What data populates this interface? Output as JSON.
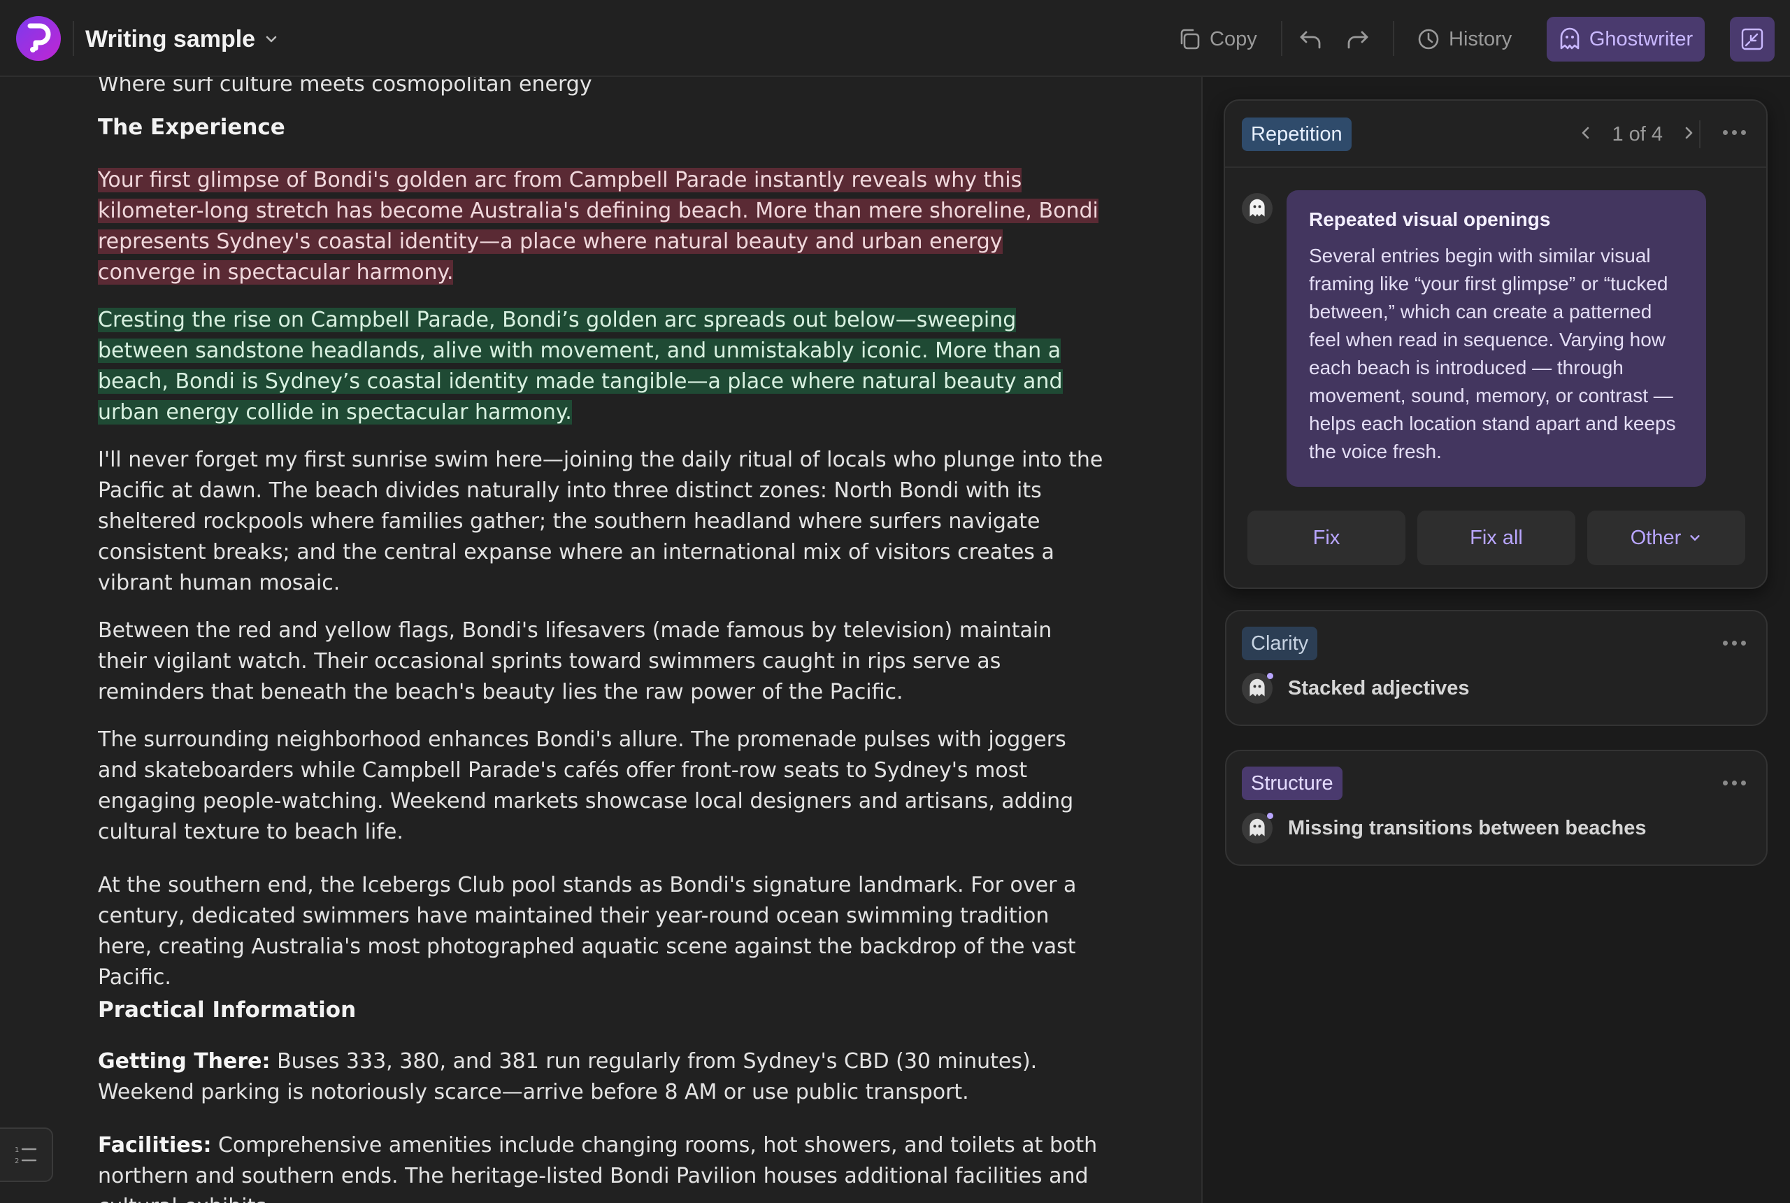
{
  "header": {
    "doc_title": "Writing sample",
    "copy_label": "Copy",
    "history_label": "History",
    "ghostwriter_label": "Ghostwriter"
  },
  "document": {
    "intro_line": "Where surf culture meets cosmopolitan energy",
    "heading_experience": "The Experience",
    "para_original": "Your first glimpse of Bondi's golden arc from Campbell Parade instantly reveals why this kilometer-long stretch has become Australia's defining beach. More than mere shoreline, Bondi represents Sydney's coastal identity—a place where natural beauty and urban energy converge in spectacular harmony.",
    "para_suggested": "Cresting the rise on Campbell Parade, Bondi’s golden arc spreads out below—sweeping between sandstone headlands, alive with movement, and unmistakably iconic. More than a beach, Bondi is Sydney’s coastal identity made tangible—a place where natural beauty and urban energy collide in spectacular harmony.",
    "para_swim": "I'll never forget my first sunrise swim here—joining the daily ritual of locals who plunge into the Pacific at dawn. The beach divides naturally into three distinct zones: North Bondi with its sheltered rockpools where families gather; the southern headland where surfers navigate consistent breaks; and the central expanse where an international mix of visitors creates a vibrant human mosaic.",
    "para_flags": "Between the red and yellow flags, Bondi's lifesavers (made famous by television) maintain their vigilant watch. Their occasional sprints toward swimmers caught in rips serve as reminders that beneath the beach's beauty lies the raw power of the Pacific.",
    "para_neighborhood": "The surrounding neighborhood enhances Bondi's allure. The promenade pulses with joggers and skateboarders while Campbell Parade's cafés offer front-row seats to Sydney's most engaging people-watching. Weekend markets showcase local designers and artisans, adding cultural texture to beach life.",
    "para_icebergs": "At the southern end, the Icebergs Club pool stands as Bondi's signature landmark. For over a century, dedicated swimmers have maintained their year-round ocean swimming tradition here, creating Australia's most photographed aquatic scene against the backdrop of the vast Pacific.",
    "heading_practical": "Practical Information",
    "getting_there_label": "Getting There:",
    "getting_there_text": " Buses 333, 380, and 381 run regularly from Sydney's CBD (30 minutes). Weekend parking is notoriously scarce—arrive before 8 AM or use public transport.",
    "facilities_label": "Facilities:",
    "facilities_text": " Comprehensive amenities include changing rooms, hot showers, and toilets at both northern and southern ends. The heritage-listed Bondi Pavilion houses additional facilities and cultural exhibits."
  },
  "panel": {
    "main_card": {
      "tag": "Repetition",
      "pager": "1 of 4",
      "title": "Repeated visual openings",
      "body": "Several entries begin with similar visual framing like “your first glimpse” or “tucked between,” which can create a patterned feel when read in sequence. Varying how each beach is introduced — through movement, sound, memory, or contrast — helps each location stand apart and keeps the voice fresh.",
      "fix_label": "Fix",
      "fix_all_label": "Fix all",
      "other_label": "Other"
    },
    "clarity_card": {
      "tag": "Clarity",
      "issue": "Stacked adjectives"
    },
    "structure_card": {
      "tag": "Structure",
      "issue": "Missing transitions between beaches"
    }
  },
  "colors": {
    "background": "#212121",
    "accent_purple": "#4a3a6e",
    "highlight_removed": "#5a2a34",
    "highlight_added": "#1f4a34"
  }
}
